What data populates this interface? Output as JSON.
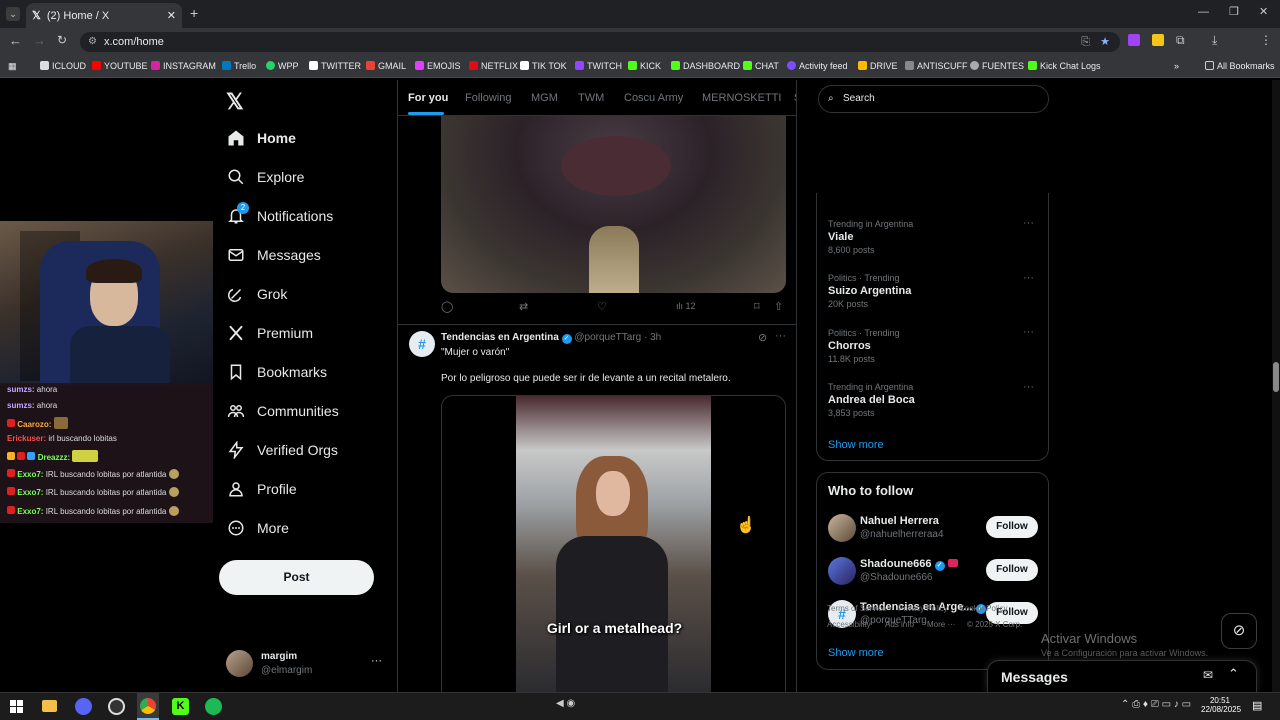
{
  "browser": {
    "tab_title": "(2) Home / X",
    "url": "x.com/home",
    "bookmarks": [
      "ICLOUD",
      "YOUTUBE",
      "INSTAGRAM",
      "Trello",
      "WPP",
      "TWITTER",
      "GMAIL",
      "EMOJIS",
      "NETFLIX",
      "TIK TOK",
      "TWITCH",
      "KICK",
      "DASHBOARD",
      "CHAT",
      "Activity feed",
      "DRIVE",
      "ANTISCUFF",
      "FUENTES",
      "Kick Chat Logs"
    ],
    "all_bookmarks": "All Bookmarks"
  },
  "nav": {
    "items": [
      "Home",
      "Explore",
      "Notifications",
      "Messages",
      "Grok",
      "Premium",
      "Bookmarks",
      "Communities",
      "Verified Orgs",
      "Profile",
      "More"
    ],
    "notif_badge": "2",
    "post_label": "Post",
    "user_name": "margim",
    "user_handle": "@elmargim"
  },
  "feed": {
    "tabs": [
      "For you",
      "Following",
      "MGM",
      "TWM",
      "Coscu Army",
      "MERNOSKETTI",
      "S"
    ],
    "prev_post_views": "12",
    "post": {
      "author": "Tendencias en Argentina",
      "handle": "@porqueTTarg",
      "time": "· 3h",
      "quote": "\"Mujer o varón\"",
      "text": "Por lo peligroso que puede ser ir de levante a un recital metalero.",
      "video_caption": "Girl or a metalhead?"
    }
  },
  "search": {
    "placeholder": "Search"
  },
  "trends": {
    "items": [
      {
        "meta": "Trending in Argentina",
        "name": "Viale",
        "count": "8,600 posts"
      },
      {
        "meta": "Politics · Trending",
        "name": "Suizo Argentina",
        "count": "20K posts"
      },
      {
        "meta": "Politics · Trending",
        "name": "Chorros",
        "count": "11.8K posts"
      },
      {
        "meta": "Trending in Argentina",
        "name": "Andrea del Boca",
        "count": "3,853 posts"
      }
    ],
    "show_more": "Show more"
  },
  "who_to_follow": {
    "title": "Who to follow",
    "users": [
      {
        "name": "Nahuel Herrera",
        "handle": "@nahuelherreraa4"
      },
      {
        "name": "Shadoune666",
        "handle": "@Shadoune666"
      },
      {
        "name": "Tendencias en Arge...",
        "handle": "@porqueTTarg"
      }
    ],
    "follow_label": "Follow",
    "show_more": "Show more"
  },
  "footer": {
    "links": [
      "Terms of Service",
      "Privacy Policy",
      "Cookie Policy",
      "Accessibility",
      "Ads info",
      "More ···",
      "© 2025 X Corp."
    ]
  },
  "messages_drawer": {
    "title": "Messages"
  },
  "windows_watermark": {
    "line1": "Activar Windows",
    "line2": "Ve a Configuración para activar Windows."
  },
  "stream_chat": [
    {
      "user": "sumzs:",
      "msg": "ahora"
    },
    {
      "user": "sumzs:",
      "msg": "ahora"
    },
    {
      "user": "Caarozo:",
      "msg": ""
    },
    {
      "user": "Erickuser:",
      "msg": "irl buscando lobitas"
    },
    {
      "user": "Dreazzz:",
      "msg": ""
    },
    {
      "user": "Exxo7:",
      "msg": "IRL buscando lobitas por atlantida"
    },
    {
      "user": "Exxo7:",
      "msg": "IRL buscando lobitas por atlantida"
    },
    {
      "user": "Exxo7:",
      "msg": "IRL buscando lobitas por atlantida"
    }
  ],
  "taskbar": {
    "time": "20:51",
    "date": "22/08/2025"
  },
  "colors": {
    "accent": "#1d9bf0",
    "bg": "#000000",
    "border": "#2f3336",
    "muted": "#71767b"
  }
}
